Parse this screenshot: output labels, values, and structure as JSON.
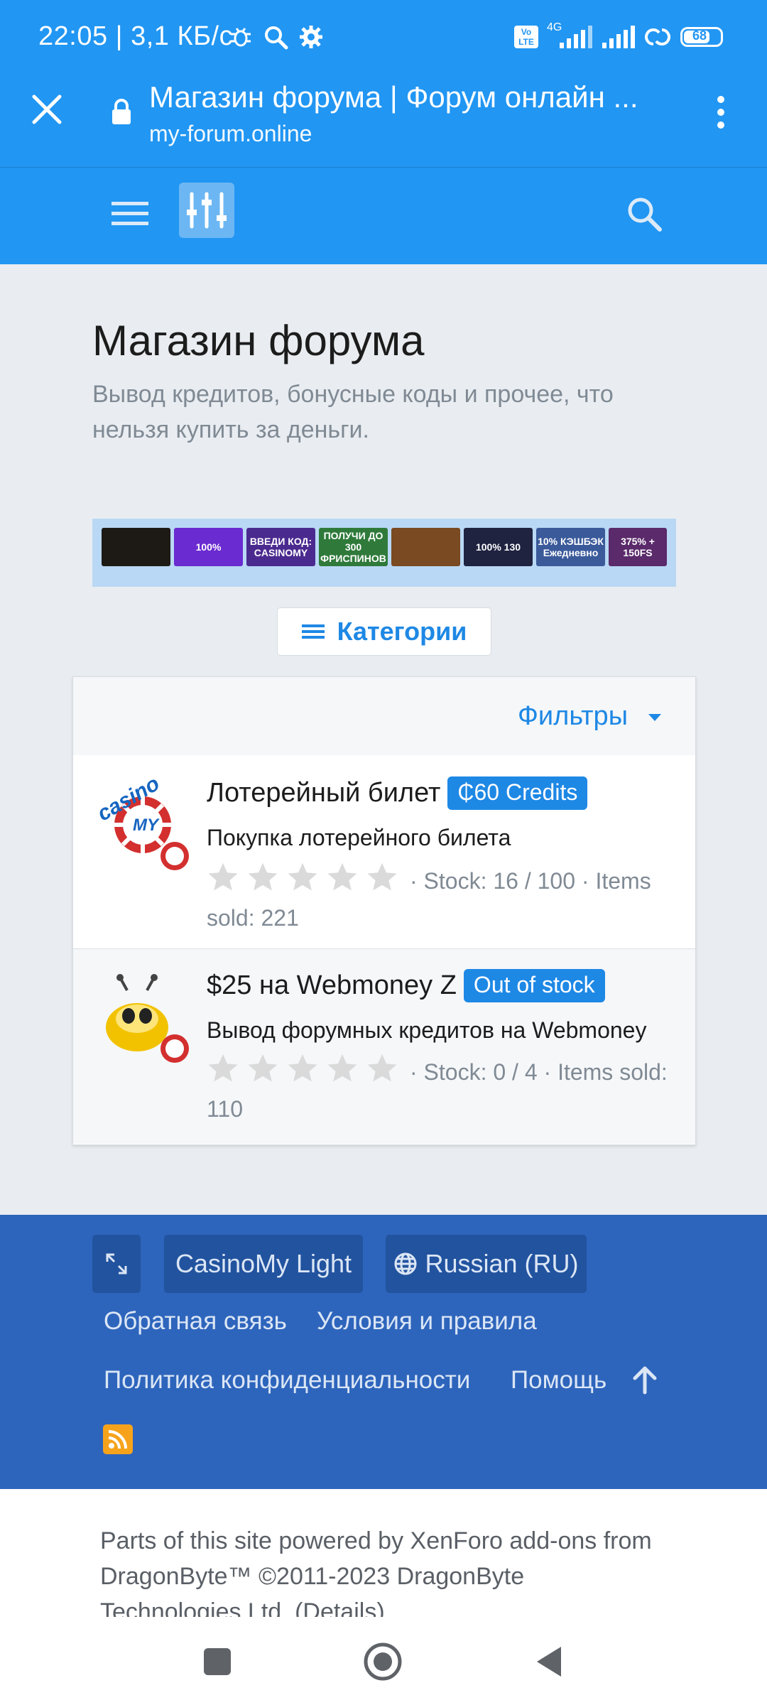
{
  "status_bar": {
    "text": "22:05 | 3,1 КБ/с",
    "battery": "68",
    "network": "4G",
    "volte": "Vo LTE"
  },
  "browser": {
    "title": "Магазин форума | Форум онлайн ...",
    "url": "my-forum.online"
  },
  "page": {
    "title": "Магазин форума",
    "description": "Вывод кредитов, бонусные коды и прочее, что нельзя купить за деньги."
  },
  "banners": [
    {
      "text": "",
      "bg": "#1d1a15"
    },
    {
      "text": "100%",
      "bg": "#6a2bd0"
    },
    {
      "text": "ВВЕДИ КОД: CASINOMY",
      "bg": "#4b2a8f"
    },
    {
      "text": "ПОЛУЧИ ДО 300 ФРИСПИНОВ",
      "bg": "#2f7a3a"
    },
    {
      "text": "",
      "bg": "#7a4a22"
    },
    {
      "text": "100% 130",
      "bg": "#1f2340"
    },
    {
      "text": "10% КЭШБЭК Ежедневно",
      "bg": "#3a5a9a"
    },
    {
      "text": "375% + 150FS",
      "bg": "#5a2a6a"
    }
  ],
  "categories_button": "Категории",
  "filters_label": "Фильтры",
  "items": [
    {
      "title": "Лотерейный билет",
      "badge": "₵60 Credits",
      "description": "Покупка лотерейного билета",
      "meta": "· Stock: 16 / 100 · Items sold: 221",
      "rating": 0
    },
    {
      "title": "$25 на Webmoney Z",
      "badge": "Out of stock",
      "description": "Вывод форумных кредитов на Webmoney",
      "meta": "· Stock: 0 / 4 · Items sold: 110",
      "rating": 0
    }
  ],
  "footer": {
    "style_label": "CasinoMy Light",
    "language_label": "Russian (RU)",
    "links": [
      "Обратная связь",
      "Условия и правила",
      "Политика конфиденциальности",
      "Помощь"
    ]
  },
  "copyright": "Parts of this site powered by XenForo add-ons from DragonByte™ ©2011-2023 DragonByte Technologies Ltd. (Details)",
  "colors": {
    "primary": "#2196f3",
    "footer": "#2e65bc",
    "link": "#1e88e5"
  }
}
